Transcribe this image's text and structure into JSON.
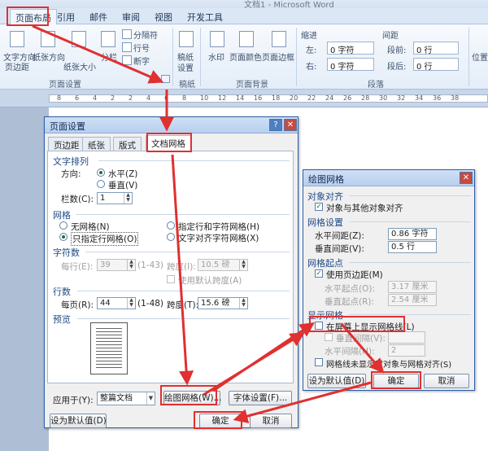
{
  "window": {
    "title": "文档1 - Microsoft Word"
  },
  "tabs": [
    "页面布局",
    "引用",
    "邮件",
    "审阅",
    "视图",
    "开发工具"
  ],
  "ribbon": {
    "page_setup": {
      "buttons": [
        "文字方向",
        "页边距",
        "纸张方向",
        "纸张大小",
        "分栏"
      ],
      "small": [
        "分隔符",
        "行号",
        "断字"
      ],
      "label": "页面设置"
    },
    "draft": {
      "button_line1": "稿纸",
      "button_line2": "设置",
      "label": "稿纸"
    },
    "background": {
      "buttons": [
        "水印",
        "页面颜色",
        "页面边框"
      ],
      "label": "页面背景"
    },
    "paragraph": {
      "indent_title": "缩进",
      "spacing_title": "间距",
      "left_label": "左:",
      "left_value": "0 字符",
      "right_label": "右:",
      "right_value": "0 字符",
      "before_label": "段前:",
      "before_value": "0 行",
      "after_label": "段后:",
      "after_value": "0 行",
      "label": "段落"
    },
    "arrange_label": "位置"
  },
  "ruler_numbers": [
    "8",
    "6",
    "4",
    "2",
    "2",
    "4",
    "6",
    "8",
    "10",
    "12",
    "14",
    "16",
    "18",
    "20",
    "22",
    "24",
    "26",
    "28",
    "30",
    "32",
    "34",
    "36",
    "38"
  ],
  "page_setup_dialog": {
    "title": "页面设置",
    "help_glyph": "?",
    "close_glyph": "✕",
    "tabs": [
      "页边距",
      "纸张",
      "版式",
      "文档网格"
    ],
    "text_arrange": {
      "title": "文字排列",
      "direction_label": "方向:",
      "horizontal": "水平(Z)",
      "vertical": "垂直(V)",
      "columns_label": "栏数(C):",
      "columns_value": "1"
    },
    "grid": {
      "title": "网格",
      "none": "无网格(N)",
      "lines_only": "只指定行网格(O)",
      "line_char": "指定行和字符网格(H)",
      "char_align": "文字对齐字符网格(X)"
    },
    "chars": {
      "title": "字符数",
      "per_line_label": "每行(E):",
      "per_line_value": "39",
      "per_line_range": "(1-43)",
      "pitch_label": "跨度(I):",
      "pitch_value": "10.5 磅",
      "default_pitch": "使用默认跨度(A)"
    },
    "lines": {
      "title": "行数",
      "per_page_label": "每页(R):",
      "per_page_value": "44",
      "per_page_range": "(1-48)",
      "pitch_label": "跨度(T):",
      "pitch_value": "15.6 磅"
    },
    "preview_title": "预览",
    "apply_label": "应用于(Y):",
    "apply_value": "整篇文档",
    "draw_grid_button": "绘图网格(W)...",
    "font_settings_button": "字体设置(F)...",
    "default_button": "设为默认值(D)",
    "ok_button": "确定",
    "cancel_button": "取消"
  },
  "drawing_grid_dialog": {
    "title": "绘图网格",
    "close_glyph": "✕",
    "snap": {
      "title": "对象对齐",
      "snap_to_objects": "对象与其他对象对齐"
    },
    "settings": {
      "title": "网格设置",
      "h_label": "水平间距(Z):",
      "h_value": "0.86 字符",
      "v_label": "垂直间距(V):",
      "v_value": "0.5 行"
    },
    "origin": {
      "title": "网格起点",
      "use_margins": "使用页边距(M)",
      "h_label": "水平起点(O):",
      "h_value": "3.17 厘米",
      "v_label": "垂直起点(R):",
      "v_value": "2.54 厘米"
    },
    "display": {
      "title": "显示网格",
      "show_grid": "在屏幕上显示网格线(L)",
      "v_interval": "垂直间隔(V):",
      "h_interval": "水平间隔(H):",
      "h_interval_value": "2",
      "not_shown": "网格线未显示时对象与网格对齐(S)"
    },
    "default_button": "设为默认值(D)",
    "ok_button": "确定",
    "cancel_button": "取消"
  },
  "colors": {
    "highlight": "#e03030",
    "titlebar": "#b7cfee",
    "accent": "#1f4a86"
  }
}
